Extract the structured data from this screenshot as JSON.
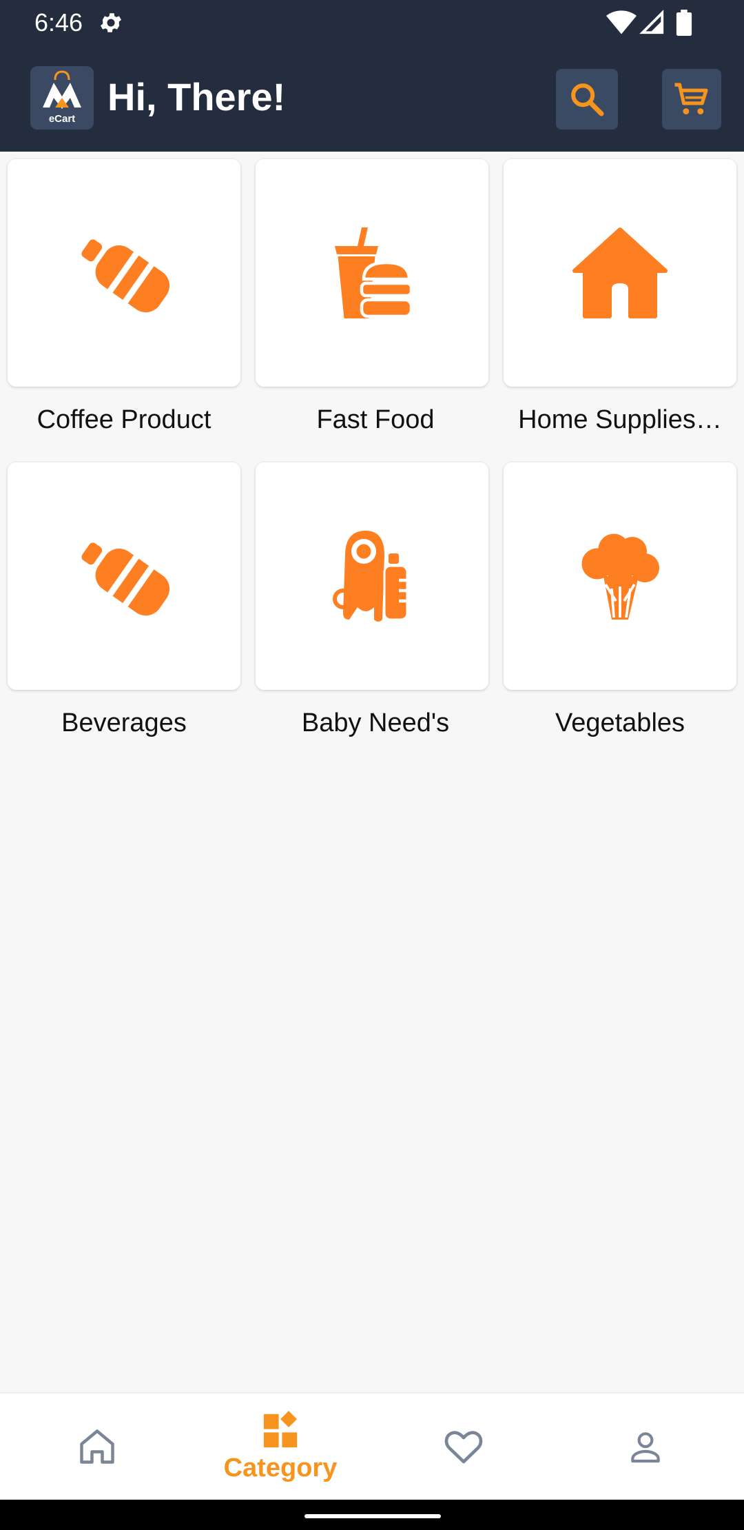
{
  "status_bar": {
    "time": "6:46",
    "icons": [
      "gear-icon",
      "wifi-icon",
      "signal-icon",
      "battery-icon"
    ]
  },
  "app_bar": {
    "logo_text": "eCart",
    "title": "Hi, There!",
    "search_icon": "search-icon",
    "cart_icon": "cart-icon"
  },
  "categories": [
    {
      "label": "Coffee Product",
      "icon": "bottle-icon"
    },
    {
      "label": "Fast Food",
      "icon": "fast-food-icon"
    },
    {
      "label": "Home Supplies…",
      "icon": "house-icon"
    },
    {
      "label": "Beverages",
      "icon": "bottle-icon"
    },
    {
      "label": "Baby Need's",
      "icon": "baby-bib-bottle-icon"
    },
    {
      "label": "Vegetables",
      "icon": "broccoli-icon"
    }
  ],
  "bottom_nav": {
    "items": [
      {
        "icon": "home-icon",
        "label": "",
        "active": false
      },
      {
        "icon": "category-icon",
        "label": "Category",
        "active": true
      },
      {
        "icon": "heart-icon",
        "label": "",
        "active": false
      },
      {
        "icon": "user-icon",
        "label": "",
        "active": false
      }
    ]
  },
  "colors": {
    "header": "#232d3e",
    "accent": "#f7941d",
    "category_icon": "#fe7f22",
    "background": "#f7f7f7",
    "nav_inactive": "#7a8597"
  }
}
